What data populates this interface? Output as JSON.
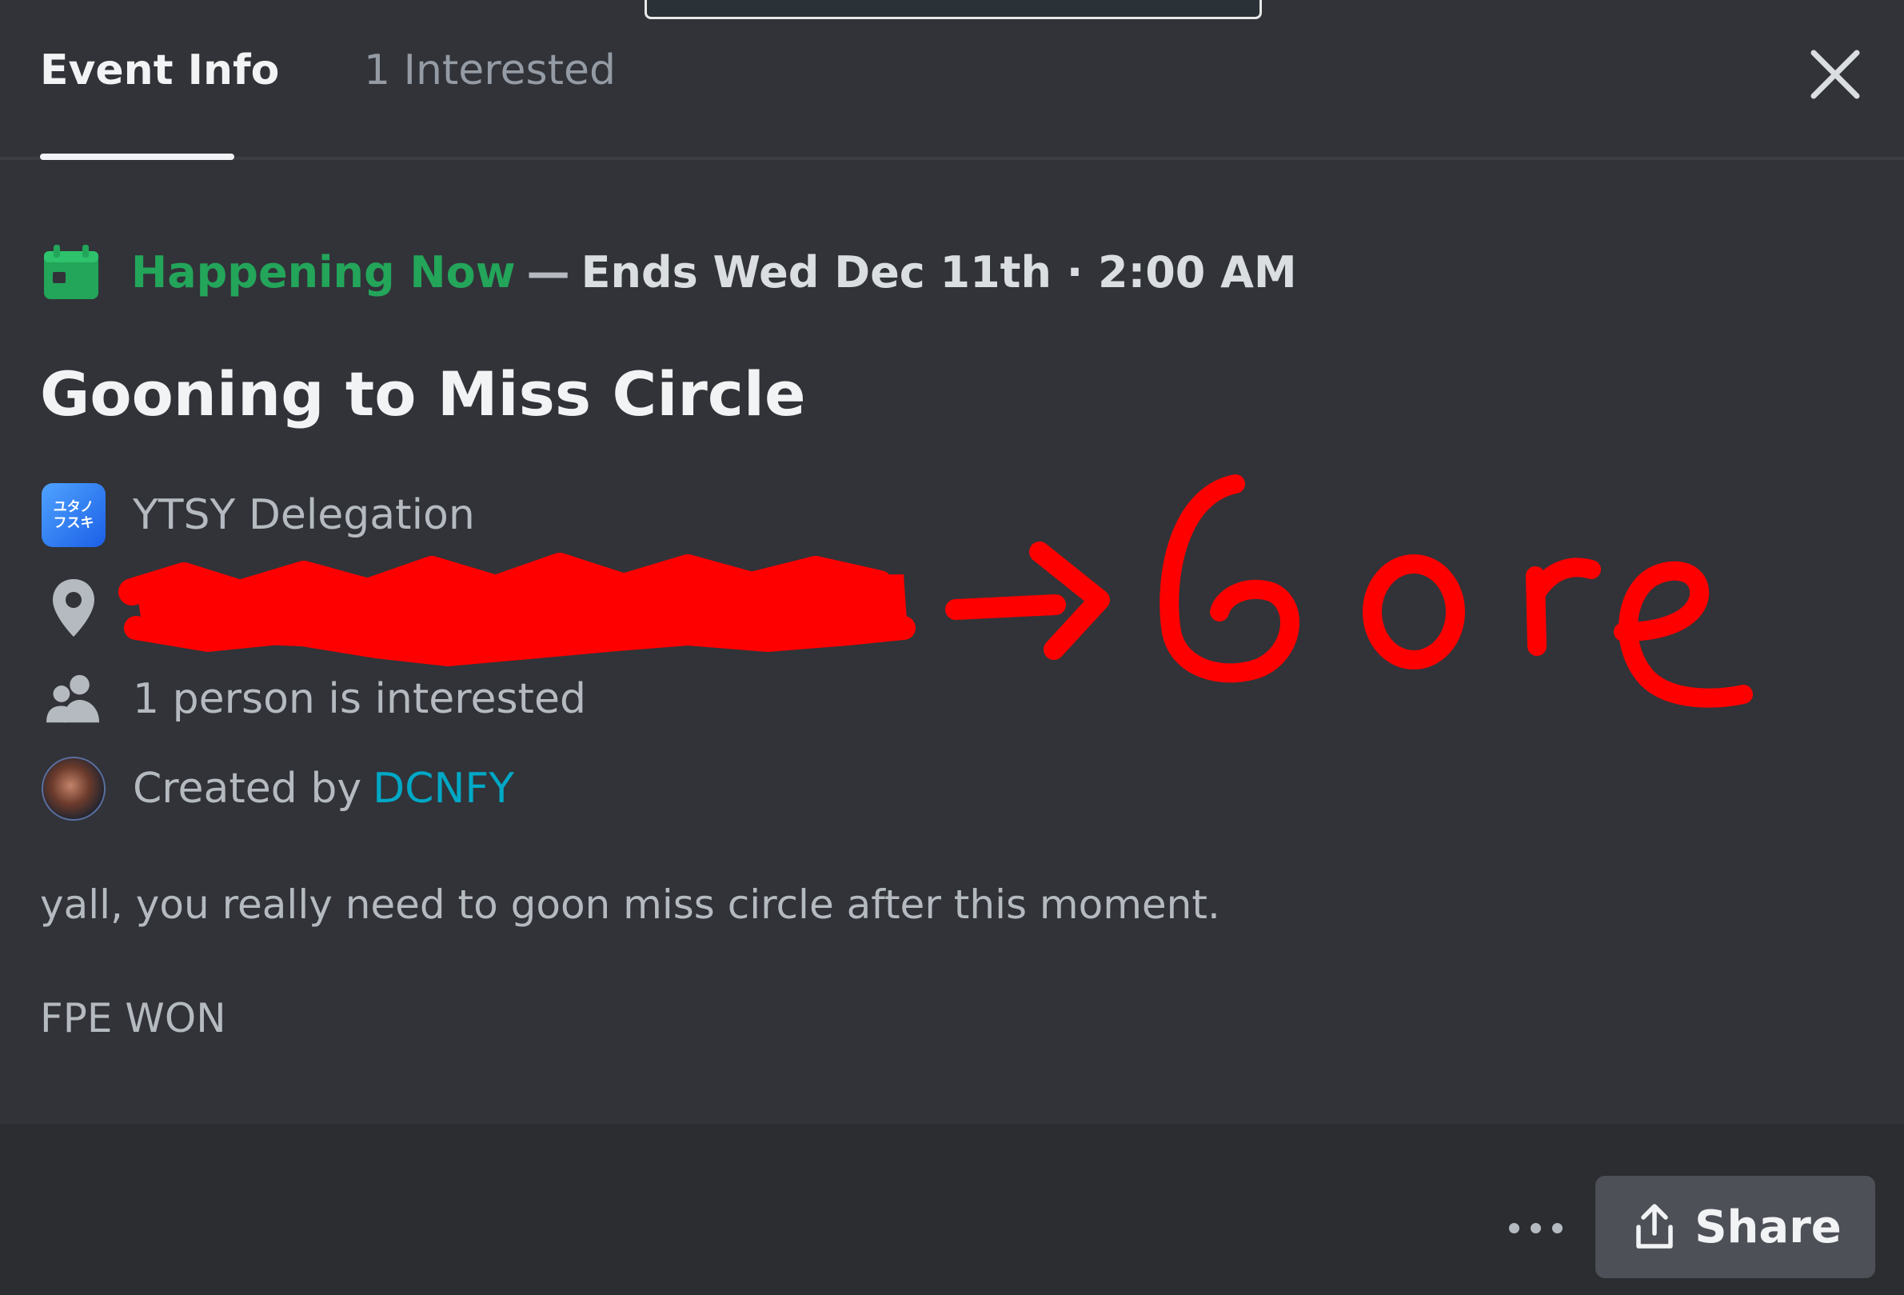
{
  "tabs": [
    {
      "label": "Event Info",
      "active": true
    },
    {
      "label": "1 Interested",
      "active": false
    }
  ],
  "status": {
    "live_label": "Happening Now",
    "separator": "—",
    "ends_text": "Ends Wed Dec 11th · 2:00 AM"
  },
  "event": {
    "title": "Gooning to Miss Circle",
    "server_name": "YTSY Delegation",
    "interested_text": "1 person is interested",
    "created_by_prefix": "Created by",
    "creator_name": "DCNFY",
    "description": "yall, you really need to goon miss circle after this moment.",
    "description_extra": "FPE WON"
  },
  "annotation": {
    "handwritten_text": "Gore",
    "color": "#ff0000"
  },
  "footer": {
    "share_label": "Share"
  },
  "colors": {
    "background": "#313338",
    "footer": "#2b2d31",
    "happening_green": "#23a55a",
    "creator_link": "#00a8c6",
    "share_button": "#4e5058"
  },
  "icons": [
    "calendar-icon",
    "server-icon",
    "location-pin-icon",
    "people-icon",
    "avatar",
    "close-icon",
    "more-icon",
    "share-icon"
  ]
}
